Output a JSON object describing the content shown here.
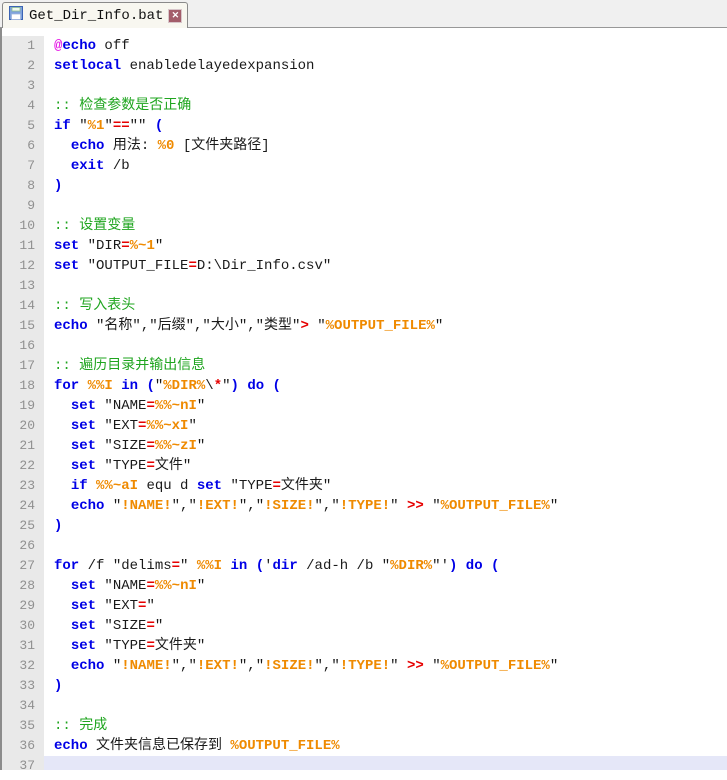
{
  "tab": {
    "title": "Get_Dir_Info.bat",
    "icons": {
      "file_state": "floppy-save-icon",
      "close": "close-x-icon"
    }
  },
  "colors": {
    "keyword": "#0000e6",
    "variable": "#ef8a00",
    "operator": "#e60000",
    "comment": "#1fa51f",
    "text": "#1a1a1a",
    "at_sign": "#e61ee6",
    "gutter_bg": "#e9e9e9",
    "gutter_text": "#909090",
    "current_line_bg": "#e5e7f8",
    "close_button_bg": "#a35d6a"
  },
  "code": {
    "language": "batch",
    "current_line": 37,
    "lines": [
      {
        "n": 1,
        "s": [
          [
            "@",
            "at"
          ],
          [
            "echo",
            "kw"
          ],
          [
            " off",
            "tx"
          ]
        ]
      },
      {
        "n": 2,
        "s": [
          [
            "setlocal",
            "kw"
          ],
          [
            " enabledelayedexpansion",
            "tx"
          ]
        ]
      },
      {
        "n": 3,
        "s": []
      },
      {
        "n": 4,
        "s": [
          [
            ":: 检查参数是否正确",
            "cmt"
          ]
        ]
      },
      {
        "n": 5,
        "s": [
          [
            "if",
            "kw"
          ],
          [
            " \"",
            "tx"
          ],
          [
            "%1",
            "var"
          ],
          [
            "\"",
            "tx"
          ],
          [
            "==",
            "op"
          ],
          [
            "\"\" ",
            "tx"
          ],
          [
            "(",
            "par"
          ]
        ]
      },
      {
        "n": 6,
        "s": [
          [
            "  ",
            "tx"
          ],
          [
            "echo",
            "kw"
          ],
          [
            " 用法: ",
            "tx"
          ],
          [
            "%0",
            "var"
          ],
          [
            " [文件夹路径]",
            "tx"
          ]
        ]
      },
      {
        "n": 7,
        "s": [
          [
            "  ",
            "tx"
          ],
          [
            "exit",
            "kw"
          ],
          [
            " /b",
            "tx"
          ]
        ]
      },
      {
        "n": 8,
        "s": [
          [
            ")",
            "par"
          ]
        ]
      },
      {
        "n": 9,
        "s": []
      },
      {
        "n": 10,
        "s": [
          [
            ":: 设置变量",
            "cmt"
          ]
        ]
      },
      {
        "n": 11,
        "s": [
          [
            "set",
            "kw"
          ],
          [
            " \"DIR",
            "tx"
          ],
          [
            "=",
            "op"
          ],
          [
            "%~1",
            "var"
          ],
          [
            "\"",
            "tx"
          ]
        ]
      },
      {
        "n": 12,
        "s": [
          [
            "set",
            "kw"
          ],
          [
            " \"OUTPUT_FILE",
            "tx"
          ],
          [
            "=",
            "op"
          ],
          [
            "D:\\Dir_Info.csv\"",
            "tx"
          ]
        ]
      },
      {
        "n": 13,
        "s": []
      },
      {
        "n": 14,
        "s": [
          [
            ":: 写入表头",
            "cmt"
          ]
        ]
      },
      {
        "n": 15,
        "s": [
          [
            "echo",
            "kw"
          ],
          [
            " \"名称\",\"后缀\",\"大小\",\"类型\"",
            "tx"
          ],
          [
            ">",
            "op"
          ],
          [
            " \"",
            "tx"
          ],
          [
            "%OUTPUT_FILE%",
            "var"
          ],
          [
            "\"",
            "tx"
          ]
        ]
      },
      {
        "n": 16,
        "s": []
      },
      {
        "n": 17,
        "s": [
          [
            ":: 遍历目录并输出信息",
            "cmt"
          ]
        ]
      },
      {
        "n": 18,
        "s": [
          [
            "for",
            "kw"
          ],
          [
            " ",
            "tx"
          ],
          [
            "%%I",
            "var"
          ],
          [
            " ",
            "tx"
          ],
          [
            "in",
            "kw"
          ],
          [
            " ",
            "tx"
          ],
          [
            "(",
            "par"
          ],
          [
            "\"",
            "tx"
          ],
          [
            "%DIR%",
            "var"
          ],
          [
            "\\",
            "tx"
          ],
          [
            "*",
            "op"
          ],
          [
            "\"",
            "tx"
          ],
          [
            ")",
            "par"
          ],
          [
            " ",
            "tx"
          ],
          [
            "do",
            "kw"
          ],
          [
            " ",
            "tx"
          ],
          [
            "(",
            "par"
          ]
        ]
      },
      {
        "n": 19,
        "s": [
          [
            "  ",
            "tx"
          ],
          [
            "set",
            "kw"
          ],
          [
            " \"NAME",
            "tx"
          ],
          [
            "=",
            "op"
          ],
          [
            "%%~nI",
            "var"
          ],
          [
            "\"",
            "tx"
          ]
        ]
      },
      {
        "n": 20,
        "s": [
          [
            "  ",
            "tx"
          ],
          [
            "set",
            "kw"
          ],
          [
            " \"EXT",
            "tx"
          ],
          [
            "=",
            "op"
          ],
          [
            "%%~xI",
            "var"
          ],
          [
            "\"",
            "tx"
          ]
        ]
      },
      {
        "n": 21,
        "s": [
          [
            "  ",
            "tx"
          ],
          [
            "set",
            "kw"
          ],
          [
            " \"SIZE",
            "tx"
          ],
          [
            "=",
            "op"
          ],
          [
            "%%~zI",
            "var"
          ],
          [
            "\"",
            "tx"
          ]
        ]
      },
      {
        "n": 22,
        "s": [
          [
            "  ",
            "tx"
          ],
          [
            "set",
            "kw"
          ],
          [
            " \"TYPE",
            "tx"
          ],
          [
            "=",
            "op"
          ],
          [
            "文件\"",
            "tx"
          ]
        ]
      },
      {
        "n": 23,
        "s": [
          [
            "  ",
            "tx"
          ],
          [
            "if",
            "kw"
          ],
          [
            " ",
            "tx"
          ],
          [
            "%%~aI",
            "var"
          ],
          [
            " equ d ",
            "tx"
          ],
          [
            "set",
            "kw"
          ],
          [
            " \"TYPE",
            "tx"
          ],
          [
            "=",
            "op"
          ],
          [
            "文件夹\"",
            "tx"
          ]
        ]
      },
      {
        "n": 24,
        "s": [
          [
            "  ",
            "tx"
          ],
          [
            "echo",
            "kw"
          ],
          [
            " \"",
            "tx"
          ],
          [
            "!NAME!",
            "var"
          ],
          [
            "\",\"",
            "tx"
          ],
          [
            "!EXT!",
            "var"
          ],
          [
            "\",\"",
            "tx"
          ],
          [
            "!SIZE!",
            "var"
          ],
          [
            "\",\"",
            "tx"
          ],
          [
            "!TYPE!",
            "var"
          ],
          [
            "\" ",
            "tx"
          ],
          [
            ">>",
            "op"
          ],
          [
            " \"",
            "tx"
          ],
          [
            "%OUTPUT_FILE%",
            "var"
          ],
          [
            "\"",
            "tx"
          ]
        ]
      },
      {
        "n": 25,
        "s": [
          [
            ")",
            "par"
          ]
        ]
      },
      {
        "n": 26,
        "s": []
      },
      {
        "n": 27,
        "s": [
          [
            "for",
            "kw"
          ],
          [
            " /f \"delims",
            "tx"
          ],
          [
            "=",
            "op"
          ],
          [
            "\" ",
            "tx"
          ],
          [
            "%%I",
            "var"
          ],
          [
            " ",
            "tx"
          ],
          [
            "in",
            "kw"
          ],
          [
            " ",
            "tx"
          ],
          [
            "(",
            "par"
          ],
          [
            "'",
            "tx"
          ],
          [
            "dir",
            "kw"
          ],
          [
            " /ad-h /b \"",
            "tx"
          ],
          [
            "%DIR%",
            "var"
          ],
          [
            "\"'",
            "tx"
          ],
          [
            ")",
            "par"
          ],
          [
            " ",
            "tx"
          ],
          [
            "do",
            "kw"
          ],
          [
            " ",
            "tx"
          ],
          [
            "(",
            "par"
          ]
        ]
      },
      {
        "n": 28,
        "s": [
          [
            "  ",
            "tx"
          ],
          [
            "set",
            "kw"
          ],
          [
            " \"NAME",
            "tx"
          ],
          [
            "=",
            "op"
          ],
          [
            "%%~nI",
            "var"
          ],
          [
            "\"",
            "tx"
          ]
        ]
      },
      {
        "n": 29,
        "s": [
          [
            "  ",
            "tx"
          ],
          [
            "set",
            "kw"
          ],
          [
            " \"EXT",
            "tx"
          ],
          [
            "=",
            "op"
          ],
          [
            "\"",
            "tx"
          ]
        ]
      },
      {
        "n": 30,
        "s": [
          [
            "  ",
            "tx"
          ],
          [
            "set",
            "kw"
          ],
          [
            " \"SIZE",
            "tx"
          ],
          [
            "=",
            "op"
          ],
          [
            "\"",
            "tx"
          ]
        ]
      },
      {
        "n": 31,
        "s": [
          [
            "  ",
            "tx"
          ],
          [
            "set",
            "kw"
          ],
          [
            " \"TYPE",
            "tx"
          ],
          [
            "=",
            "op"
          ],
          [
            "文件夹\"",
            "tx"
          ]
        ]
      },
      {
        "n": 32,
        "s": [
          [
            "  ",
            "tx"
          ],
          [
            "echo",
            "kw"
          ],
          [
            " \"",
            "tx"
          ],
          [
            "!NAME!",
            "var"
          ],
          [
            "\",\"",
            "tx"
          ],
          [
            "!EXT!",
            "var"
          ],
          [
            "\",\"",
            "tx"
          ],
          [
            "!SIZE!",
            "var"
          ],
          [
            "\",\"",
            "tx"
          ],
          [
            "!TYPE!",
            "var"
          ],
          [
            "\" ",
            "tx"
          ],
          [
            ">>",
            "op"
          ],
          [
            " \"",
            "tx"
          ],
          [
            "%OUTPUT_FILE%",
            "var"
          ],
          [
            "\"",
            "tx"
          ]
        ]
      },
      {
        "n": 33,
        "s": [
          [
            ")",
            "par"
          ]
        ]
      },
      {
        "n": 34,
        "s": []
      },
      {
        "n": 35,
        "s": [
          [
            ":: 完成",
            "cmt"
          ]
        ]
      },
      {
        "n": 36,
        "s": [
          [
            "echo",
            "kw"
          ],
          [
            " 文件夹信息已保存到 ",
            "tx"
          ],
          [
            "%OUTPUT_FILE%",
            "var"
          ]
        ]
      },
      {
        "n": 37,
        "s": []
      }
    ]
  }
}
